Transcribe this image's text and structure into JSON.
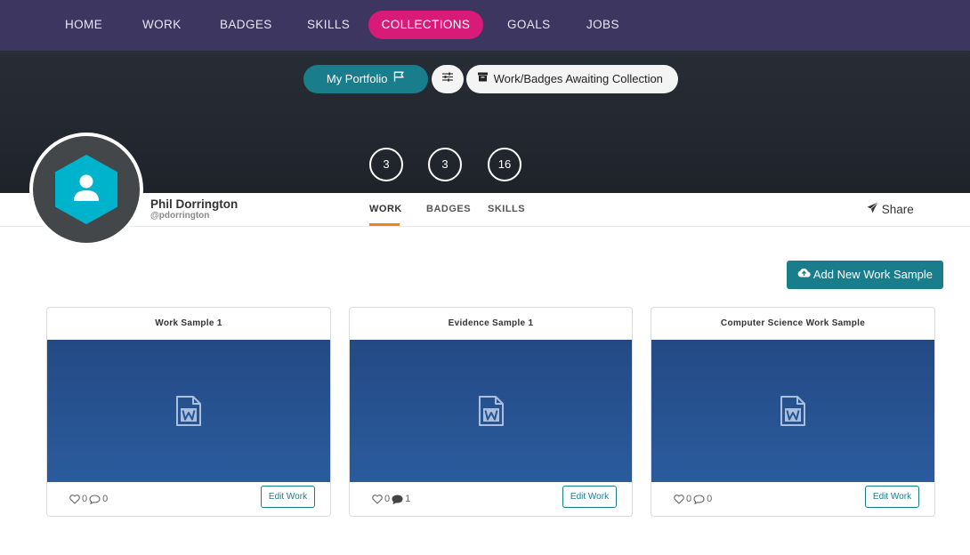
{
  "nav": {
    "items": [
      {
        "label": "HOME"
      },
      {
        "label": "WORK"
      },
      {
        "label": "BADGES"
      },
      {
        "label": "SKILLS"
      },
      {
        "label": "COLLECTIONS",
        "active": true
      },
      {
        "label": "GOALS"
      },
      {
        "label": "JOBS"
      }
    ]
  },
  "hero": {
    "portfolio_label": "My Portfolio",
    "portfolio_icon": "flag-icon",
    "filter_icon": "sliders-icon",
    "awaiting_icon": "archive-icon",
    "awaiting_label": "Work/Badges Awaiting Collection",
    "stats": [
      "3",
      "3",
      "16"
    ]
  },
  "profile": {
    "name": "Phil Dorrington",
    "handle": "@pdorrington",
    "avatar_icon": "user-hexagon-icon",
    "tabs": [
      {
        "label": "WORK",
        "active": true
      },
      {
        "label": "BADGES"
      },
      {
        "label": "SKILLS"
      }
    ],
    "share_label": "Share",
    "share_icon": "paper-plane-icon"
  },
  "actions": {
    "add_label": "Add New Work Sample",
    "add_icon": "cloud-upload-icon"
  },
  "cards": [
    {
      "title": "Work Sample 1",
      "likes": "0",
      "comments": "0",
      "edit_label": "Edit Work",
      "comments_filled": false
    },
    {
      "title": "Evidence Sample 1",
      "likes": "0",
      "comments": "1",
      "edit_label": "Edit Work",
      "comments_filled": true
    },
    {
      "title": "Computer Science Work Sample",
      "likes": "0",
      "comments": "0",
      "edit_label": "Edit Work",
      "comments_filled": false
    }
  ],
  "colors": {
    "nav_bg": "#3d3660",
    "active_pink": "#d81b78",
    "teal": "#1a7d8c",
    "tab_underline": "#f0821e",
    "thumb_blue": "#2b5b9d",
    "avatar_hex": "#00b3cc"
  }
}
